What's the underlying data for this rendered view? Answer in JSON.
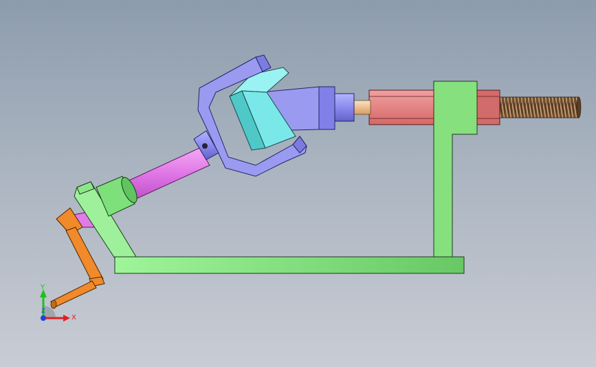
{
  "viewport": {
    "background_top": "#8d9cad",
    "background_bottom": "#c9ccd4"
  },
  "assembly": {
    "parts": [
      {
        "name": "base-plate",
        "color": "#8ee68a"
      },
      {
        "name": "upright-frame",
        "color": "#86e07e"
      },
      {
        "name": "angled-frame",
        "color": "#9ef09a"
      },
      {
        "name": "threaded-rod",
        "color": "#7a5a3a"
      },
      {
        "name": "red-sleeve",
        "color": "#e57a7a"
      },
      {
        "name": "output-shaft",
        "color": "#f0c090"
      },
      {
        "name": "blue-yoke",
        "color": "#9a9af0"
      },
      {
        "name": "cyan-cross-block",
        "color": "#7ae8e8"
      },
      {
        "name": "magenta-shaft",
        "color": "#e27ae8"
      },
      {
        "name": "green-bushing",
        "color": "#7ee07a"
      },
      {
        "name": "orange-crank",
        "color": "#f08a2a"
      }
    ]
  },
  "triad": {
    "x_label": "X",
    "y_label": "Y",
    "z_label": "Z",
    "x_color": "#e02020",
    "y_color": "#20c020",
    "z_color": "#2040e0"
  }
}
